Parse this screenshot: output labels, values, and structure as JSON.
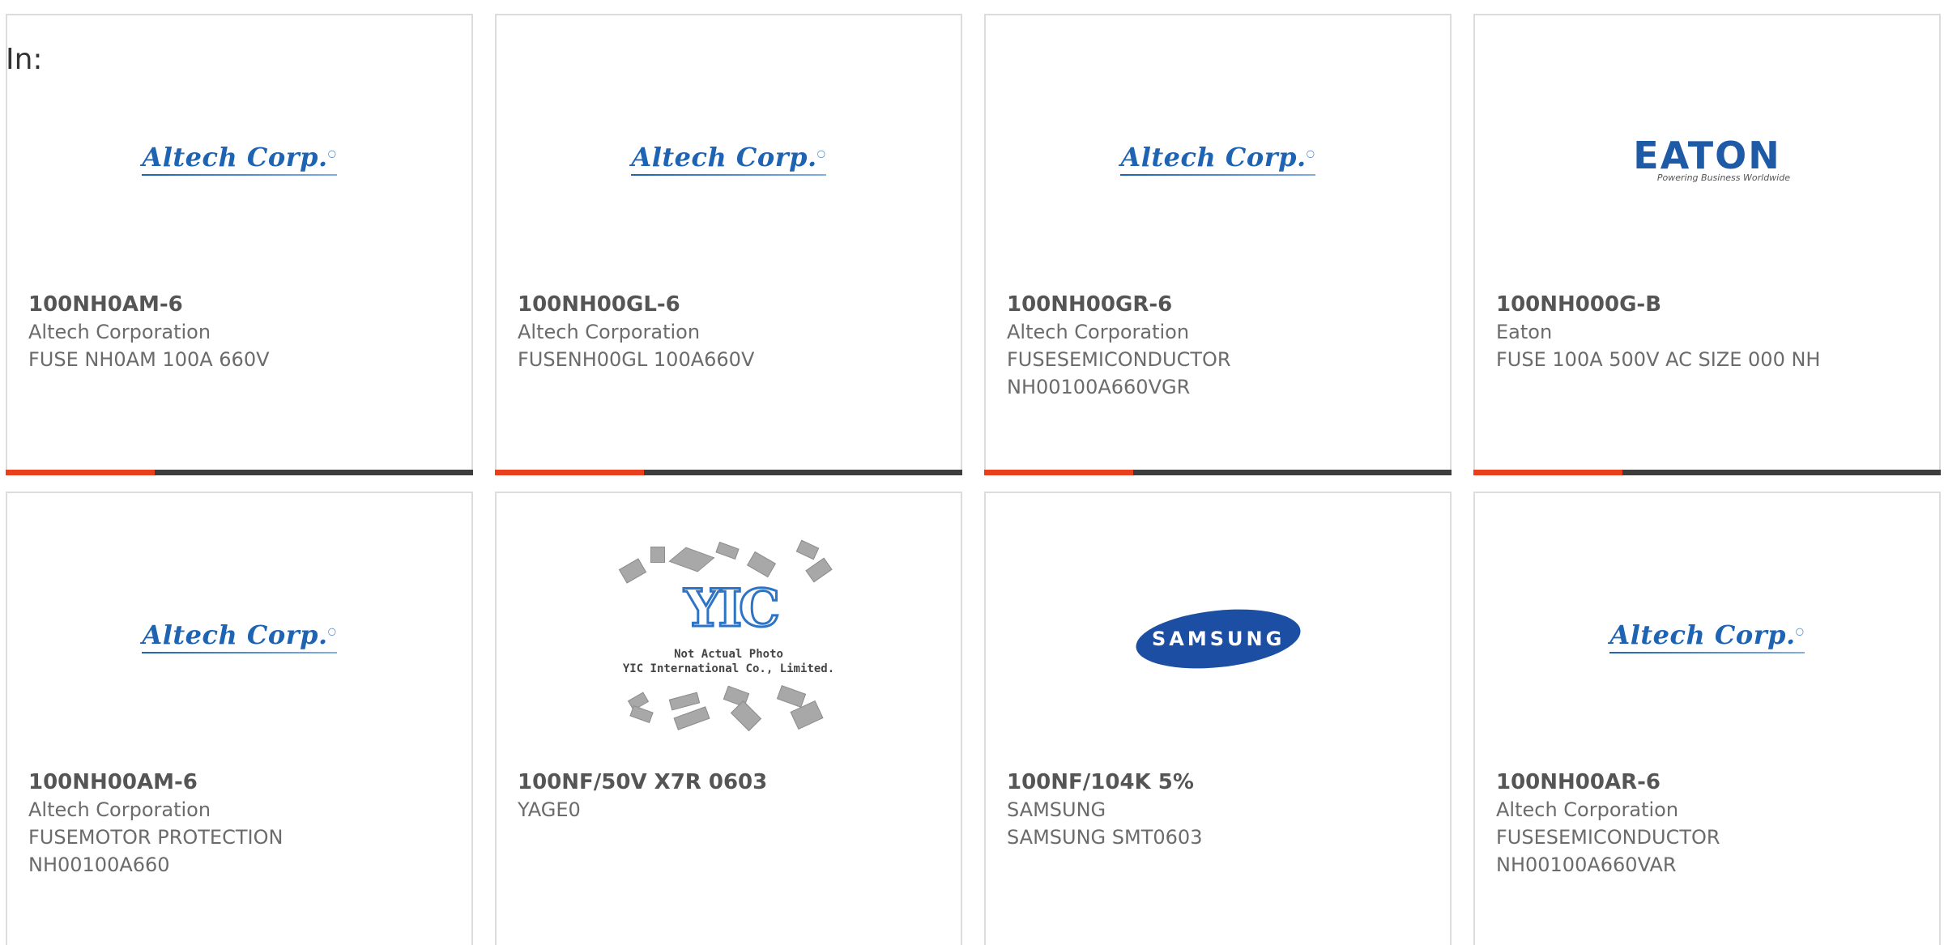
{
  "filter_label": "In:",
  "cards": [
    {
      "part": "100NH0AM-6",
      "manufacturer": "Altech Corporation",
      "description": [
        "FUSE NH0AM 100A 660V"
      ],
      "logo": "Altech Corp."
    },
    {
      "part": "100NH00GL-6",
      "manufacturer": "Altech Corporation",
      "description": [
        "FUSENH00GL 100A660V"
      ],
      "logo": "Altech Corp."
    },
    {
      "part": "100NH00GR-6",
      "manufacturer": "Altech Corporation",
      "description": [
        "FUSESEMICONDUCTOR",
        "NH00100A660VGR"
      ],
      "logo": "Altech Corp."
    },
    {
      "part": "100NH000G-B",
      "manufacturer": "Eaton",
      "description": [
        "FUSE 100A 500V AC SIZE 000 NH"
      ],
      "logo": "EATON",
      "logo_tagline": "Powering Business Worldwide"
    },
    {
      "part": "100NH00AM-6",
      "manufacturer": "Altech Corporation",
      "description": [
        "FUSEMOTOR PROTECTION",
        "NH00100A660"
      ],
      "logo": "Altech Corp."
    },
    {
      "part": "100NF/50V X7R 0603",
      "manufacturer": "YAGE0",
      "description": [],
      "logo": "YIC",
      "logo_caption": [
        "Not Actual Photo",
        "YIC International Co., Limited."
      ]
    },
    {
      "part": "100NF/104K 5%",
      "manufacturer": "SAMSUNG",
      "description": [
        "SAMSUNG SMT0603"
      ],
      "logo": "SAMSUNG"
    },
    {
      "part": "100NH00AR-6",
      "manufacturer": "Altech Corporation",
      "description": [
        "FUSESEMICONDUCTOR",
        "NH00100A660VAR"
      ],
      "logo": "Altech Corp."
    }
  ],
  "colors": {
    "accent": "#e8401c",
    "bar": "#3d3d3d",
    "altech_blue": "#1f63b3",
    "eaton_blue": "#1f5aa6",
    "samsung_blue": "#1c4fa3",
    "text": "#6b6b6b"
  }
}
